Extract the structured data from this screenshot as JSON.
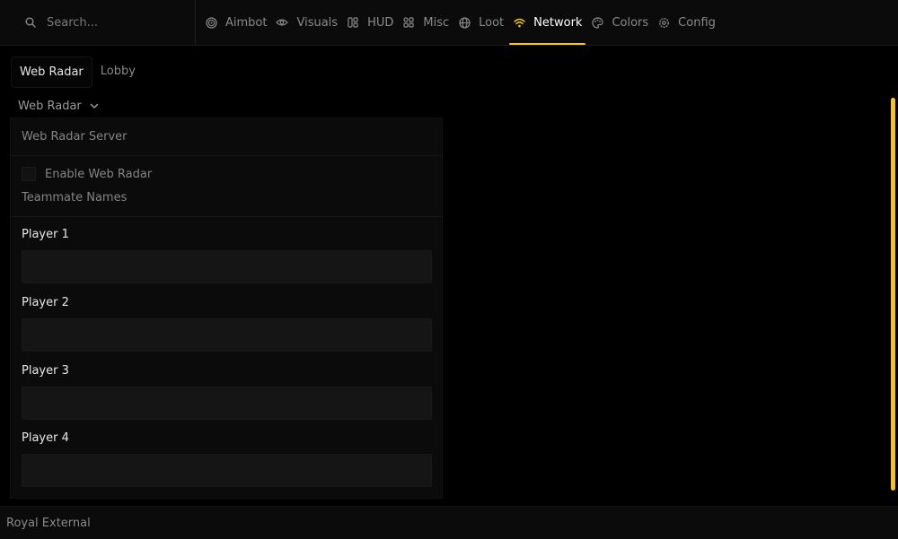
{
  "search": {
    "placeholder": "Search..."
  },
  "nav": {
    "tabs": [
      {
        "label": "Aimbot",
        "icon": "target-icon"
      },
      {
        "label": "Visuals",
        "icon": "eye-icon"
      },
      {
        "label": "HUD",
        "icon": "hud-icon"
      },
      {
        "label": "Misc",
        "icon": "grid-icon"
      },
      {
        "label": "Loot",
        "icon": "globe-icon"
      },
      {
        "label": "Network",
        "icon": "wifi-icon"
      },
      {
        "label": "Colors",
        "icon": "palette-icon"
      },
      {
        "label": "Config",
        "icon": "gear-icon"
      }
    ],
    "active": "Network"
  },
  "section_tabs": [
    "Web Radar",
    "Lobby"
  ],
  "dropdown": {
    "label": "Web Radar"
  },
  "panel": {
    "header": "Web Radar Server",
    "enable_label": "Enable Web Radar",
    "enable_checked": false,
    "subheader": "Teammate Names",
    "players": [
      {
        "label": "Player 1",
        "value": ""
      },
      {
        "label": "Player 2",
        "value": ""
      },
      {
        "label": "Player 3",
        "value": ""
      },
      {
        "label": "Player 4",
        "value": ""
      }
    ]
  },
  "footer": {
    "title": "Royal External"
  },
  "colors": {
    "accent": "#f5c518",
    "background": "#000000",
    "panel": "#0b0b0b"
  }
}
